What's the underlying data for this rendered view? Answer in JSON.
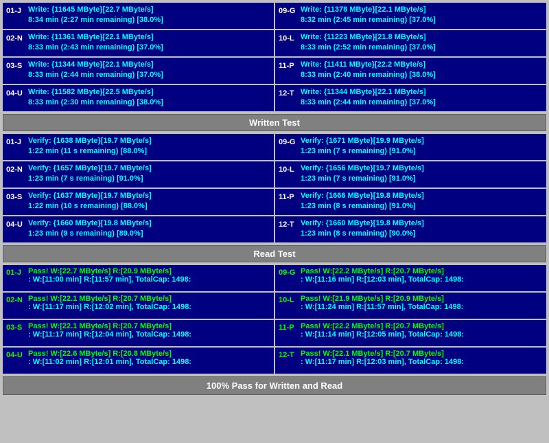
{
  "sections": {
    "write_test": {
      "label": "Written Test",
      "cells": [
        {
          "id": "01-J",
          "col": "left",
          "line1": "Write: {11645 MByte}[22.7 MByte/s]",
          "line2": "8:34 min (2:27 min remaining)  [38.0%]"
        },
        {
          "id": "09-G",
          "col": "right",
          "line1": "Write: {11378 MByte}[22.1 MByte/s]",
          "line2": "8:32 min (2:45 min remaining)  [37.0%]"
        },
        {
          "id": "02-N",
          "col": "left",
          "line1": "Write: {11361 MByte}[22.1 MByte/s]",
          "line2": "8:33 min (2:43 min remaining)  [37.0%]"
        },
        {
          "id": "10-L",
          "col": "right",
          "line1": "Write: {11223 MByte}[21.8 MByte/s]",
          "line2": "8:33 min (2:52 min remaining)  [37.0%]"
        },
        {
          "id": "03-S",
          "col": "left",
          "line1": "Write: {11344 MByte}[22.1 MByte/s]",
          "line2": "8:33 min (2:44 min remaining)  [37.0%]"
        },
        {
          "id": "11-P",
          "col": "right",
          "line1": "Write: {11411 MByte}[22.2 MByte/s]",
          "line2": "8:33 min (2:40 min remaining)  [38.0%]"
        },
        {
          "id": "04-U",
          "col": "left",
          "line1": "Write: {11582 MByte}[22.5 MByte/s]",
          "line2": "8:33 min (2:30 min remaining)  [38.0%]"
        },
        {
          "id": "12-T",
          "col": "right",
          "line1": "Write: {11344 MByte}[22.1 MByte/s]",
          "line2": "8:33 min (2:44 min remaining)  [37.0%]"
        }
      ]
    },
    "verify_test": {
      "label": "Written Test",
      "cells": [
        {
          "id": "01-J",
          "col": "left",
          "line1": "Verify: {1638 MByte}[19.7 MByte/s]",
          "line2": "1:22 min (11 s remaining)  [88.0%]"
        },
        {
          "id": "09-G",
          "col": "right",
          "line1": "Verify: {1671 MByte}[19.9 MByte/s]",
          "line2": "1:23 min (7 s remaining)  [91.0%]"
        },
        {
          "id": "02-N",
          "col": "left",
          "line1": "Verify: {1657 MByte}[19.7 MByte/s]",
          "line2": "1:23 min (7 s remaining)  [91.0%]"
        },
        {
          "id": "10-L",
          "col": "right",
          "line1": "Verify: {1656 MByte}[19.7 MByte/s]",
          "line2": "1:23 min (7 s remaining)  [91.0%]"
        },
        {
          "id": "03-S",
          "col": "left",
          "line1": "Verify: {1637 MByte}[19.7 MByte/s]",
          "line2": "1:22 min (10 s remaining)  [88.0%]"
        },
        {
          "id": "11-P",
          "col": "right",
          "line1": "Verify: {1666 MByte}[19.8 MByte/s]",
          "line2": "1:23 min (8 s remaining)  [91.0%]"
        },
        {
          "id": "04-U",
          "col": "left",
          "line1": "Verify: {1660 MByte}[19.8 MByte/s]",
          "line2": "1:23 min (9 s remaining)  [89.0%]"
        },
        {
          "id": "12-T",
          "col": "right",
          "line1": "Verify: {1660 MByte}[19.8 MByte/s]",
          "line2": "1:23 min (8 s remaining)  [90.0%]"
        }
      ]
    },
    "read_test": {
      "label": "Read Test",
      "cells": [
        {
          "id": "01-J",
          "col": "left",
          "pass": true,
          "line1": "Pass! W:[22.7 MByte/s] R:[20.9 MByte/s]",
          "line2": ": W:[11:00 min] R:[11:57 min], TotalCap: 1498:"
        },
        {
          "id": "09-G",
          "col": "right",
          "pass": true,
          "line1": "Pass! W:[22.2 MByte/s] R:[20.7 MByte/s]",
          "line2": ": W:[11:16 min] R:[12:03 min], TotalCap: 1498:"
        },
        {
          "id": "02-N",
          "col": "left",
          "pass": true,
          "line1": "Pass! W:[22.1 MByte/s] R:[20.7 MByte/s]",
          "line2": ": W:[11:17 min] R:[12:02 min], TotalCap: 1498:"
        },
        {
          "id": "10-L",
          "col": "right",
          "pass": true,
          "line1": "Pass! W:[21.9 MByte/s] R:[20.9 MByte/s]",
          "line2": ": W:[11:24 min] R:[11:57 min], TotalCap: 1498:"
        },
        {
          "id": "03-S",
          "col": "left",
          "pass": true,
          "line1": "Pass! W:[22.1 MByte/s] R:[20.7 MByte/s]",
          "line2": ": W:[11:17 min] R:[12:04 min], TotalCap: 1498:"
        },
        {
          "id": "11-P",
          "col": "right",
          "pass": true,
          "line1": "Pass! W:[22.2 MByte/s] R:[20.7 MByte/s]",
          "line2": ": W:[11:14 min] R:[12:05 min], TotalCap: 1498:"
        },
        {
          "id": "04-U",
          "col": "left",
          "pass": true,
          "line1": "Pass! W:[22.6 MByte/s] R:[20.8 MByte/s]",
          "line2": ": W:[11:02 min] R:[12:01 min], TotalCap: 1498:"
        },
        {
          "id": "12-T",
          "col": "right",
          "pass": true,
          "line1": "Pass! W:[22.1 MByte/s] R:[20.7 MByte/s]",
          "line2": ": W:[11:17 min] R:[12:03 min], TotalCap: 1498:"
        }
      ]
    }
  },
  "headers": {
    "written_test": "Written Test",
    "read_test": "Read Test",
    "footer": "100% Pass for Written and Read"
  }
}
